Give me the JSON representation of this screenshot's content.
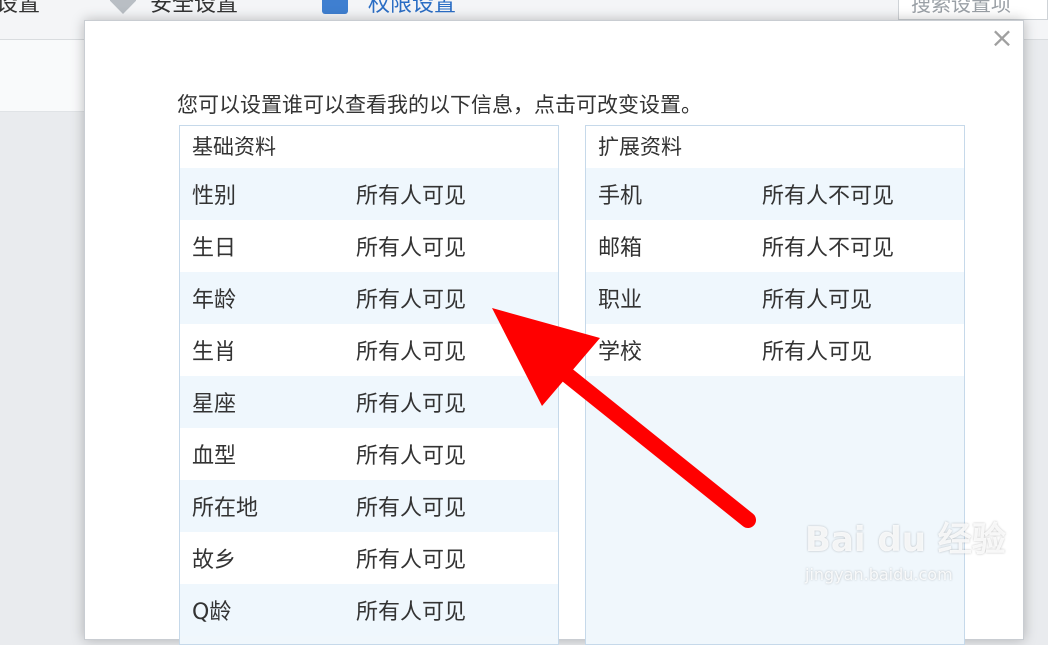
{
  "background": {
    "tabs": [
      "设置",
      "安全设置",
      "权限设置"
    ],
    "search_placeholder": "搜索设置项"
  },
  "dialog": {
    "close_label": "×",
    "intro": "您可以设置谁可以查看我的以下信息，点击可改变设置。",
    "basic": {
      "title": "基础资料",
      "rows": [
        {
          "label": "性别",
          "value": "所有人可见"
        },
        {
          "label": "生日",
          "value": "所有人可见"
        },
        {
          "label": "年龄",
          "value": "所有人可见"
        },
        {
          "label": "生肖",
          "value": "所有人可见"
        },
        {
          "label": "星座",
          "value": "所有人可见"
        },
        {
          "label": "血型",
          "value": "所有人可见"
        },
        {
          "label": "所在地",
          "value": "所有人可见"
        },
        {
          "label": "故乡",
          "value": "所有人可见"
        },
        {
          "label": "Q龄",
          "value": "所有人可见"
        }
      ]
    },
    "extended": {
      "title": "扩展资料",
      "rows": [
        {
          "label": "手机",
          "value": "所有人不可见"
        },
        {
          "label": "邮箱",
          "value": "所有人不可见"
        },
        {
          "label": "职业",
          "value": "所有人可见"
        },
        {
          "label": "学校",
          "value": "所有人可见"
        }
      ]
    }
  },
  "annotation": {
    "arrow_color": "#ff0000"
  },
  "watermark": {
    "main": "Bai du 经验",
    "sub": "jingyan.baidu.com"
  }
}
